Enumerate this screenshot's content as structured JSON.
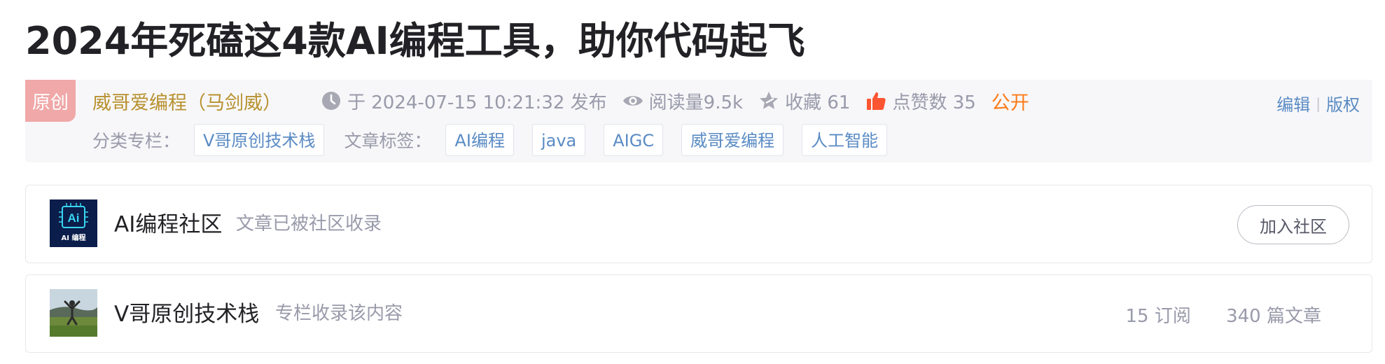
{
  "article": {
    "title": "2024年死磕这4款AI编程工具，助你代码起飞"
  },
  "meta": {
    "badge": "原创",
    "author": "威哥爱编程（马剑威）",
    "publish": "于 2024-07-15 10:21:32 发布",
    "views": "阅读量9.5k",
    "favorites": "收藏 61",
    "likes": "点赞数 35",
    "visibility": "公开",
    "edit": "编辑",
    "copyright": "版权",
    "category_label": "分类专栏：",
    "category": "V哥原创技术栈",
    "tags_label": "文章标签：",
    "tags": [
      "AI编程",
      "java",
      "AIGC",
      "威哥爱编程",
      "人工智能"
    ]
  },
  "community": {
    "name": "AI编程社区",
    "desc": "文章已被社区收录",
    "join": "加入社区",
    "logo_text_top": "Ai",
    "logo_text_bottom": "AI 编程"
  },
  "column": {
    "name": "V哥原创技术栈",
    "desc": "专栏收录该内容",
    "subscriptions": "15 订阅",
    "articles": "340 篇文章"
  },
  "colors": {
    "author": "#b8912f",
    "public": "#fc7c1a",
    "link": "#5a8bc4",
    "badge": "#f0a8a8",
    "like_icon": "#fc5531"
  },
  "icons": [
    "clock-icon",
    "eye-icon",
    "star-icon",
    "thumbs-up-icon"
  ]
}
